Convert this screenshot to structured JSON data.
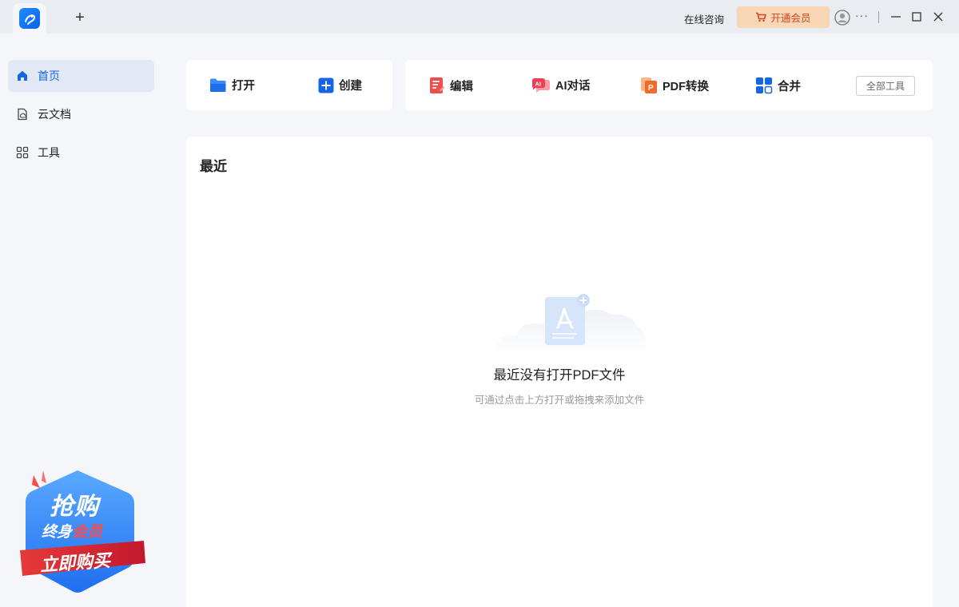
{
  "titlebar": {
    "new_tab_label": "+",
    "consult_label": "在线咨询",
    "vip_label": "开通会员",
    "more_label": "···"
  },
  "sidebar": {
    "items": [
      {
        "label": "首页",
        "icon": "home-icon",
        "active": true
      },
      {
        "label": "云文档",
        "icon": "cloud-doc-icon",
        "active": false
      },
      {
        "label": "工具",
        "icon": "grid-icon",
        "active": false
      }
    ],
    "promo": {
      "line1": "抢购",
      "line2_a": "终身",
      "line2_b": "会员",
      "button": "立即购买"
    }
  },
  "toolbar": {
    "open_label": "打开",
    "create_label": "创建",
    "edit_label": "编辑",
    "ai_label": "AI对话",
    "convert_label": "PDF转换",
    "merge_label": "合并",
    "all_tools_label": "全部工具"
  },
  "recent": {
    "title": "最近",
    "empty_title": "最近没有打开PDF文件",
    "empty_subtitle": "可通过点击上方打开或拖拽来添加文件"
  },
  "colors": {
    "accent": "#1565e5",
    "vip_bg": "#f7d7b5",
    "vip_text": "#d5441c"
  }
}
